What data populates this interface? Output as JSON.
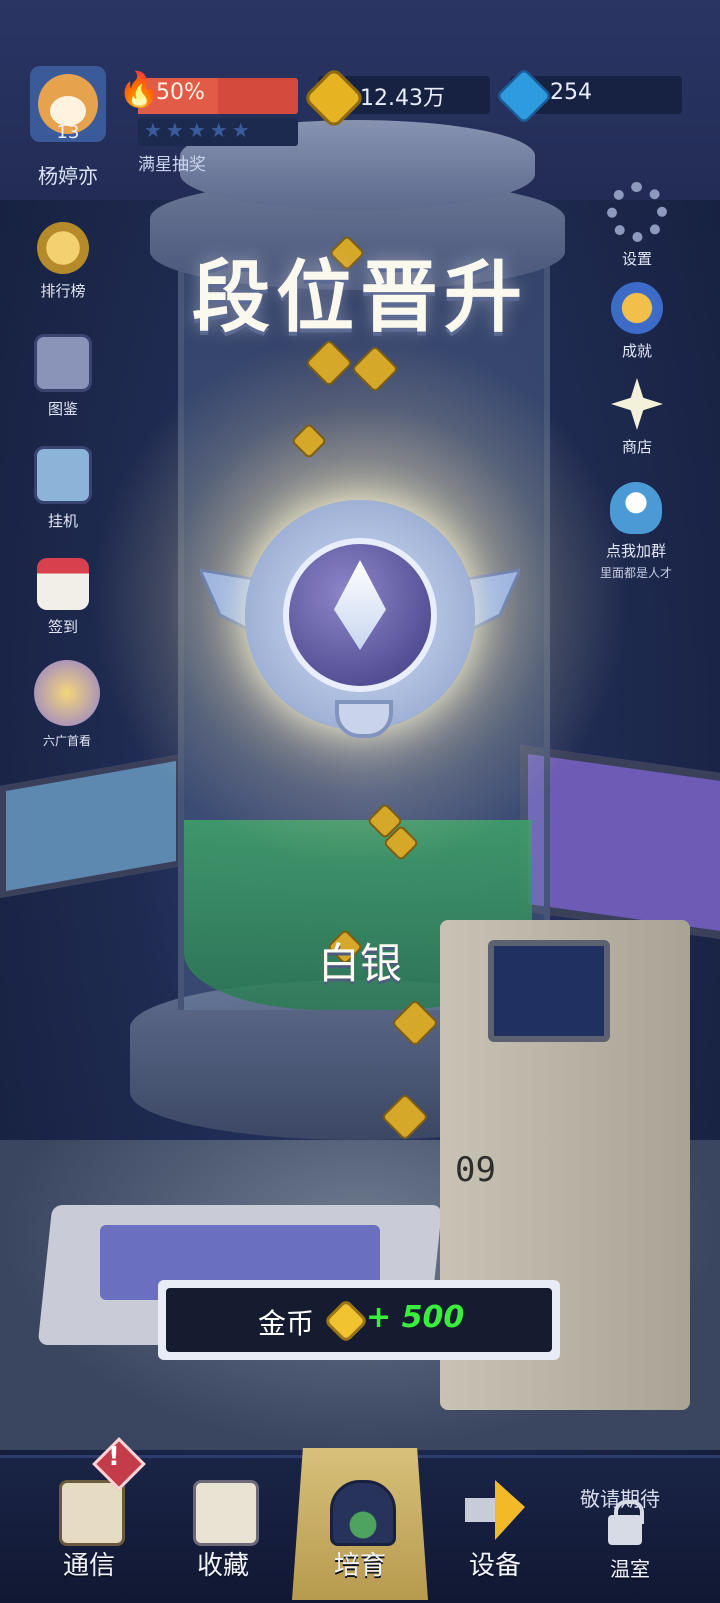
{
  "player": {
    "name": "杨婷亦",
    "level": "13",
    "fire_progress_text": "50%",
    "fire_progress": 0.5,
    "star_lottery_label": "满星抽奖"
  },
  "currency": {
    "coins": "12.43万",
    "gems": "254"
  },
  "left_menu": [
    {
      "label": "排行榜",
      "icon": "medal-icon"
    },
    {
      "label": "图鉴",
      "icon": "book-icon"
    },
    {
      "label": "挂机",
      "icon": "robot-icon"
    },
    {
      "label": "签到",
      "icon": "calendar-icon"
    },
    {
      "label": "六广首看",
      "icon": "video-ad-icon"
    }
  ],
  "right_menu": [
    {
      "label": "设置",
      "icon": "gear-icon"
    },
    {
      "label": "成就",
      "icon": "achievement-icon"
    },
    {
      "label": "商店",
      "icon": "shop-icon"
    },
    {
      "label": "点我加群",
      "sub": "里面都是人才",
      "icon": "penguin-icon"
    }
  ],
  "promotion": {
    "title": "段位晋升",
    "rank_name": "白银"
  },
  "reward": {
    "label": "金币",
    "amount": "+ 500"
  },
  "scene": {
    "machine_number": "09"
  },
  "bottom_nav": [
    {
      "label": "通信",
      "icon": "clipboard-icon"
    },
    {
      "label": "收藏",
      "icon": "box-icon"
    },
    {
      "label": "培育",
      "icon": "plant-jar-icon"
    },
    {
      "label": "设备",
      "icon": "upgrade-arrow-icon"
    },
    {
      "label": "温室",
      "icon": "lock-icon"
    }
  ],
  "coming_soon": "敬请期待",
  "alert_mark": "!",
  "colors": {
    "reward_green": "#39ee3c",
    "coin_gold": "#e6b323",
    "gem_blue": "#2e9be0",
    "fire_red": "#d44a3c"
  }
}
